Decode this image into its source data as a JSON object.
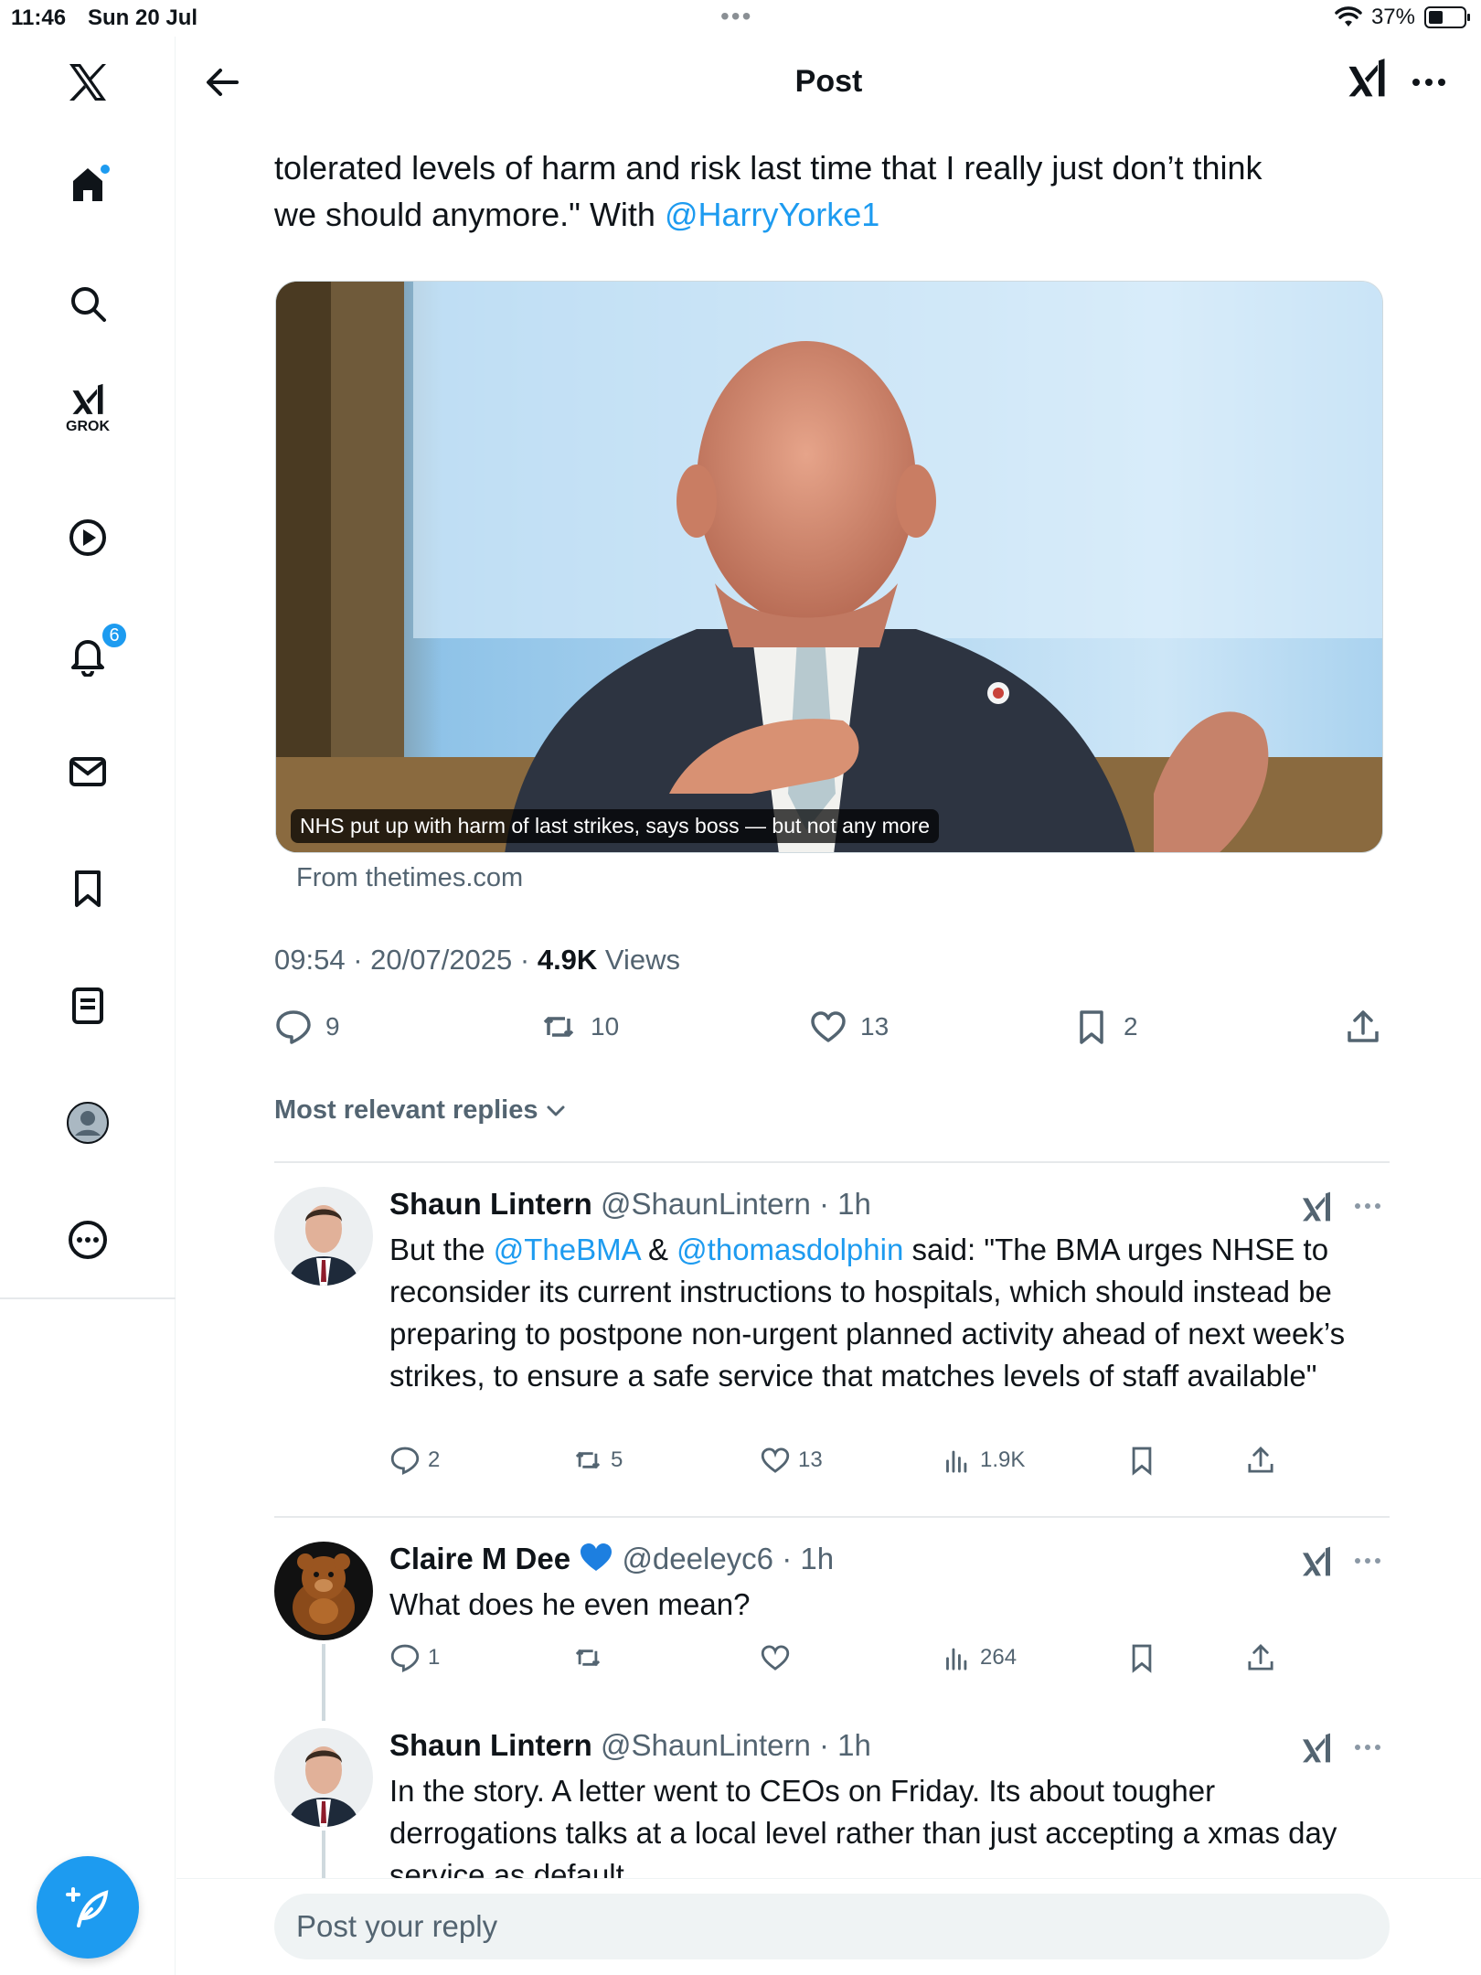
{
  "status_bar": {
    "time": "11:46",
    "date": "Sun 20 Jul",
    "battery": "37%"
  },
  "sidebar": {
    "grok_label": "GROK",
    "notifications_badge": "6"
  },
  "header": {
    "title": "Post"
  },
  "tweet": {
    "text_line1": "tolerated levels of harm and risk last time that I really just don’t think",
    "text_line2_pre": "we should anymore.\" With ",
    "mention": "@HarryYorke1",
    "card_caption": "NHS put up with harm of last strikes, says boss — but not any more",
    "card_from": "From thetimes.com",
    "time": "09:54 · 20/07/2025 · ",
    "views_count": "4.9K",
    "views_label": " Views",
    "stats": {
      "replies": "9",
      "reposts": "10",
      "likes": "13",
      "bookmarks": "2"
    }
  },
  "replies_sort": "Most relevant replies",
  "replies": [
    {
      "name": "Shaun Lintern",
      "handle": "@ShaunLintern · 1h",
      "body_pre": "But the ",
      "mention1": "@TheBMA",
      "body_mid": " & ",
      "mention2": "@thomasdolphin",
      "body_post": " said: \"The BMA urges NHSE to reconsider its current instructions to hospitals, which should instead be preparing to postpone non-urgent planned activity ahead of next week’s strikes, to ensure a safe service that matches levels of staff available\"",
      "stats": {
        "replies": "2",
        "reposts": "5",
        "likes": "13",
        "views": "1.9K"
      }
    },
    {
      "name": "Claire M Dee",
      "handle": "@deeleyc6 · 1h",
      "body": "What does he even mean?",
      "stats": {
        "replies": "1",
        "reposts": "",
        "likes": "",
        "views": "264"
      }
    },
    {
      "name": "Shaun Lintern",
      "handle": "@ShaunLintern · 1h",
      "body": "In the story. A letter went to CEOs on Friday. Its about tougher derrogations talks at a local level rather than just accepting a xmas day service as default"
    }
  ],
  "reply_bar": {
    "placeholder": "Post your reply"
  }
}
